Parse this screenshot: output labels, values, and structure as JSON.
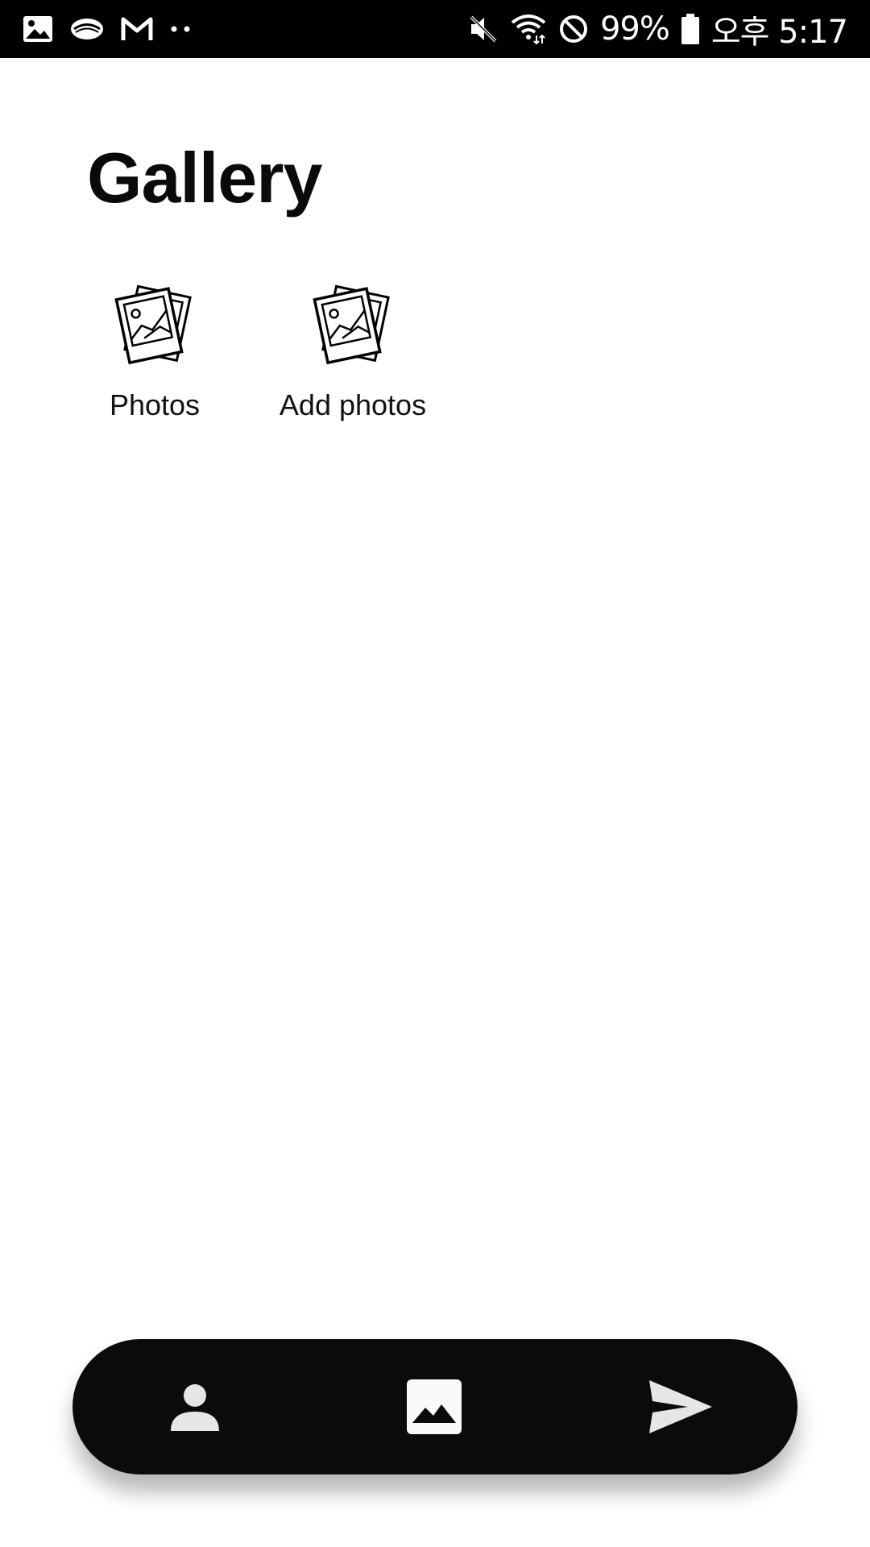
{
  "status_bar": {
    "left_icons": [
      "gallery-notification-icon",
      "cloud-app-icon",
      "gmail-icon",
      "more-dots-icon"
    ],
    "right_icons": [
      "mute-icon",
      "wifi-icon",
      "do-not-disturb-icon",
      "battery-icon"
    ],
    "battery_percent": "99%",
    "time": "오후 5:17"
  },
  "header": {
    "title": "Gallery"
  },
  "gallery": {
    "items": [
      {
        "label": "Photos",
        "icon": "photo-stack-icon"
      },
      {
        "label": "Add photos",
        "icon": "photo-stack-icon"
      }
    ]
  },
  "bottom_nav": {
    "items": [
      {
        "icon": "person-icon"
      },
      {
        "icon": "image-icon"
      },
      {
        "icon": "send-icon"
      }
    ]
  },
  "colors": {
    "background": "#ffffff",
    "status_bar": "#000000",
    "nav_bar": "#0b0b0b",
    "nav_icon": "#e6e6e6",
    "title": "#0a0a0a"
  }
}
